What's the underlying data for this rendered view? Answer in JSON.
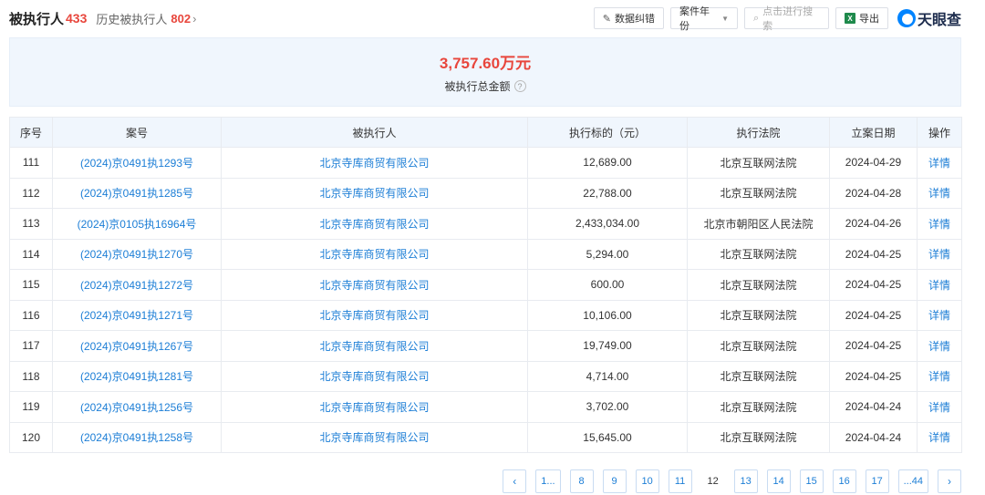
{
  "header": {
    "title": "被执行人",
    "title_count": "433",
    "history_label": "历史被执行人",
    "history_count": "802",
    "history_chevron": "›"
  },
  "toolbar": {
    "correct_label": "数据纠错",
    "year_label": "案件年份",
    "search_placeholder": "点击进行搜索",
    "export_label": "导出",
    "logo_text": "天眼查"
  },
  "summary": {
    "amount": "3,757.60万元",
    "label": "被执行总金额"
  },
  "table": {
    "headers": [
      "序号",
      "案号",
      "被执行人",
      "执行标的（元）",
      "执行法院",
      "立案日期",
      "操作"
    ],
    "rows": [
      {
        "no": "111",
        "case": "(2024)京0491执1293号",
        "party": "北京寺库商贸有限公司",
        "amount": "12,689.00",
        "court": "北京互联网法院",
        "date": "2024-04-29",
        "action": "详情"
      },
      {
        "no": "112",
        "case": "(2024)京0491执1285号",
        "party": "北京寺库商贸有限公司",
        "amount": "22,788.00",
        "court": "北京互联网法院",
        "date": "2024-04-28",
        "action": "详情"
      },
      {
        "no": "113",
        "case": "(2024)京0105执16964号",
        "party": "北京寺库商贸有限公司",
        "amount": "2,433,034.00",
        "court": "北京市朝阳区人民法院",
        "date": "2024-04-26",
        "action": "详情"
      },
      {
        "no": "114",
        "case": "(2024)京0491执1270号",
        "party": "北京寺库商贸有限公司",
        "amount": "5,294.00",
        "court": "北京互联网法院",
        "date": "2024-04-25",
        "action": "详情"
      },
      {
        "no": "115",
        "case": "(2024)京0491执1272号",
        "party": "北京寺库商贸有限公司",
        "amount": "600.00",
        "court": "北京互联网法院",
        "date": "2024-04-25",
        "action": "详情"
      },
      {
        "no": "116",
        "case": "(2024)京0491执1271号",
        "party": "北京寺库商贸有限公司",
        "amount": "10,106.00",
        "court": "北京互联网法院",
        "date": "2024-04-25",
        "action": "详情"
      },
      {
        "no": "117",
        "case": "(2024)京0491执1267号",
        "party": "北京寺库商贸有限公司",
        "amount": "19,749.00",
        "court": "北京互联网法院",
        "date": "2024-04-25",
        "action": "详情"
      },
      {
        "no": "118",
        "case": "(2024)京0491执1281号",
        "party": "北京寺库商贸有限公司",
        "amount": "4,714.00",
        "court": "北京互联网法院",
        "date": "2024-04-25",
        "action": "详情"
      },
      {
        "no": "119",
        "case": "(2024)京0491执1256号",
        "party": "北京寺库商贸有限公司",
        "amount": "3,702.00",
        "court": "北京互联网法院",
        "date": "2024-04-24",
        "action": "详情"
      },
      {
        "no": "120",
        "case": "(2024)京0491执1258号",
        "party": "北京寺库商贸有限公司",
        "amount": "15,645.00",
        "court": "北京互联网法院",
        "date": "2024-04-24",
        "action": "详情"
      }
    ]
  },
  "pagination": {
    "prev": "‹",
    "pages": [
      "1...",
      "8",
      "9",
      "10",
      "11",
      "12",
      "13",
      "14",
      "15",
      "16",
      "17",
      "...44"
    ],
    "current": "12",
    "next": "›"
  },
  "colors": {
    "accent_red": "#e8463c",
    "link_blue": "#1c7ed6",
    "header_bg": "#f0f6fd"
  }
}
